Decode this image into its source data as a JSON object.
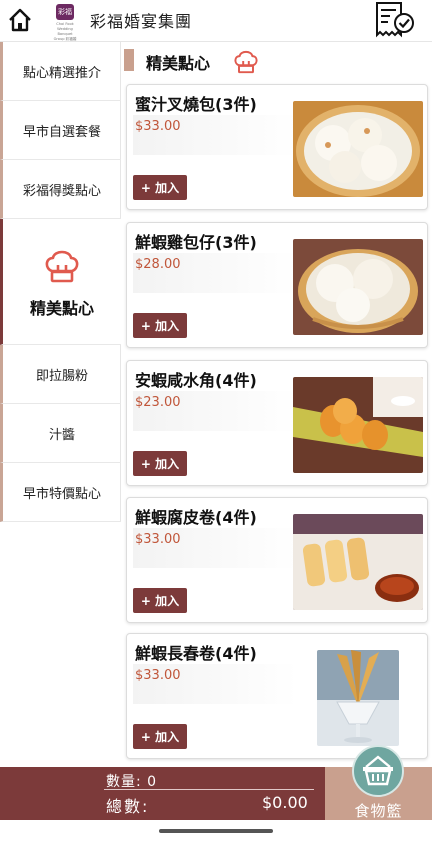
{
  "header": {
    "title": "彩福婚宴集團",
    "logo_mark": "彩福",
    "logo_caption": "Choi Fook Wedding Banquet Group 彩福婚宴集團",
    "home_icon": "home-icon",
    "receipt_icon": "receipt-check-icon"
  },
  "sidebar": {
    "items": [
      {
        "label": "點心精選推介"
      },
      {
        "label": "早市自選套餐"
      },
      {
        "label": "彩福得獎點心"
      },
      {
        "label": "精美點心"
      },
      {
        "label": "即拉腸粉"
      },
      {
        "label": "汁醬"
      },
      {
        "label": "早市特價點心"
      }
    ]
  },
  "section": {
    "title": "精美點心",
    "icon": "chef-hat-icon"
  },
  "products": [
    {
      "name": "蜜汁叉燒包(3件)",
      "price": "$33.00",
      "add_label": "+ 加入"
    },
    {
      "name": "鮮蝦雞包仔(3件)",
      "price": "$28.00",
      "add_label": "+ 加入"
    },
    {
      "name": "安蝦咸水角(4件)",
      "price": "$23.00",
      "add_label": "+ 加入"
    },
    {
      "name": "鮮蝦腐皮卷(4件)",
      "price": "$33.00",
      "add_label": "+ 加入"
    },
    {
      "name": "鮮蝦長春卷(4件)",
      "price": "$33.00",
      "add_label": "+ 加入"
    }
  ],
  "cart": {
    "qty_label": "數量: 0",
    "total_label": "總數:",
    "total_value": "$0.00",
    "basket_label": "食物籃",
    "basket_icon": "basket-icon"
  },
  "colors": {
    "brand": "#7c3a3a",
    "accent": "#c9a08e",
    "price": "#c0563a",
    "basket": "#6fa6a0"
  }
}
